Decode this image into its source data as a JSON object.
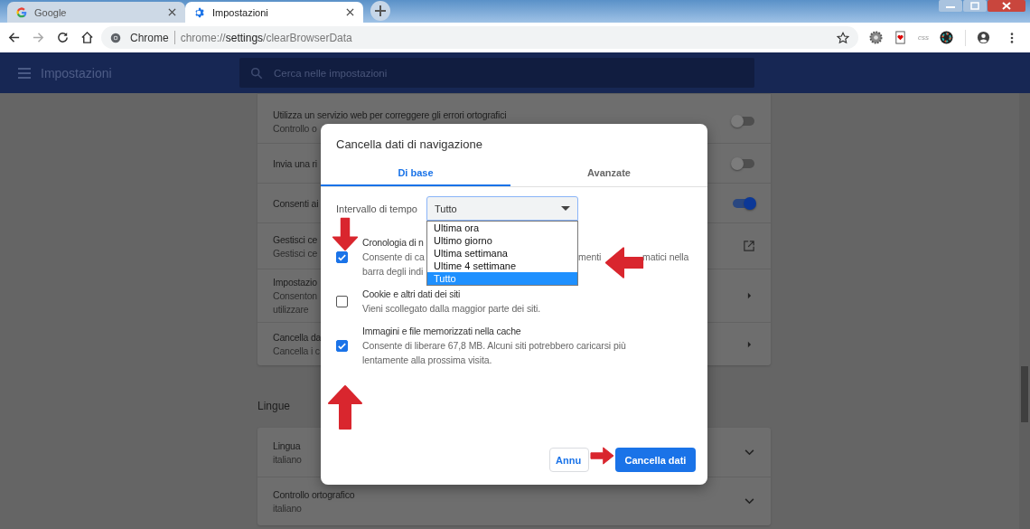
{
  "browser": {
    "tabs": [
      {
        "title": "Google",
        "selected": false
      },
      {
        "title": "Impostazioni",
        "selected": true
      }
    ],
    "address": {
      "chip": "Chrome",
      "url_scheme": "chrome://",
      "url_host": "settings",
      "url_path": "/clearBrowserData"
    },
    "extension_label": "css"
  },
  "header": {
    "title": "Impostazioni",
    "search_placeholder": "Cerca nelle impostazioni"
  },
  "settings_rows": [
    {
      "kind": "toggle",
      "title": "Utilizza un servizio web per correggere gli errori ortografici",
      "lines": [
        "Controllo o"
      ],
      "on": false
    },
    {
      "kind": "toggle",
      "title": "Invia una ri",
      "lines": [],
      "on": false
    },
    {
      "kind": "toggle",
      "title": "Consenti ai",
      "lines": [],
      "on": true
    },
    {
      "kind": "external",
      "title": "Gestisci ce",
      "lines": [
        "Gestisci ce"
      ]
    },
    {
      "kind": "submenu",
      "title": "Impostazio",
      "lines": [
        "Consenton",
        "utilizzare"
      ]
    },
    {
      "kind": "submenu",
      "title": "Cancella da",
      "lines": [
        "Cancella i c"
      ]
    }
  ],
  "languages": {
    "heading": "Lingue",
    "rows": [
      {
        "title": "Lingua",
        "value": "italiano"
      },
      {
        "title": "Controllo ortografico",
        "value": "italiano"
      }
    ]
  },
  "dialog": {
    "title": "Cancella dati di navigazione",
    "tabs": [
      {
        "label": "Di base",
        "selected": true
      },
      {
        "label": "Avanzate",
        "selected": false
      }
    ],
    "range": {
      "label": "Intervallo di tempo",
      "value": "Tutto",
      "options": [
        {
          "label": "Ultima ora",
          "selected": false
        },
        {
          "label": "Ultimo giorno",
          "selected": false
        },
        {
          "label": "Ultima settimana",
          "selected": false
        },
        {
          "label": "Ultime 4 settimane",
          "selected": false
        },
        {
          "label": "Tutto",
          "selected": true
        }
      ]
    },
    "items": [
      {
        "title": "Cronologia di n",
        "checked": true,
        "lines": [
          [
            "Consente di ca",
            "menti",
            "matici nella"
          ],
          [
            "barra degli indi"
          ]
        ]
      },
      {
        "title": "Cookie e altri dati dei siti",
        "checked": false,
        "lines": [
          [
            "Vieni scollegato dalla maggior parte dei siti."
          ]
        ]
      },
      {
        "title": "Immagini e file memorizzati nella cache",
        "checked": true,
        "lines": [
          [
            "Consente di liberare 67,8 MB. Alcuni siti potrebbero caricarsi più"
          ],
          [
            "lentamente alla prossima visita."
          ]
        ]
      }
    ],
    "buttons": [
      {
        "label": "Annu",
        "kind": "secondary"
      },
      {
        "label": "Cancella dati",
        "kind": "primary"
      }
    ]
  }
}
